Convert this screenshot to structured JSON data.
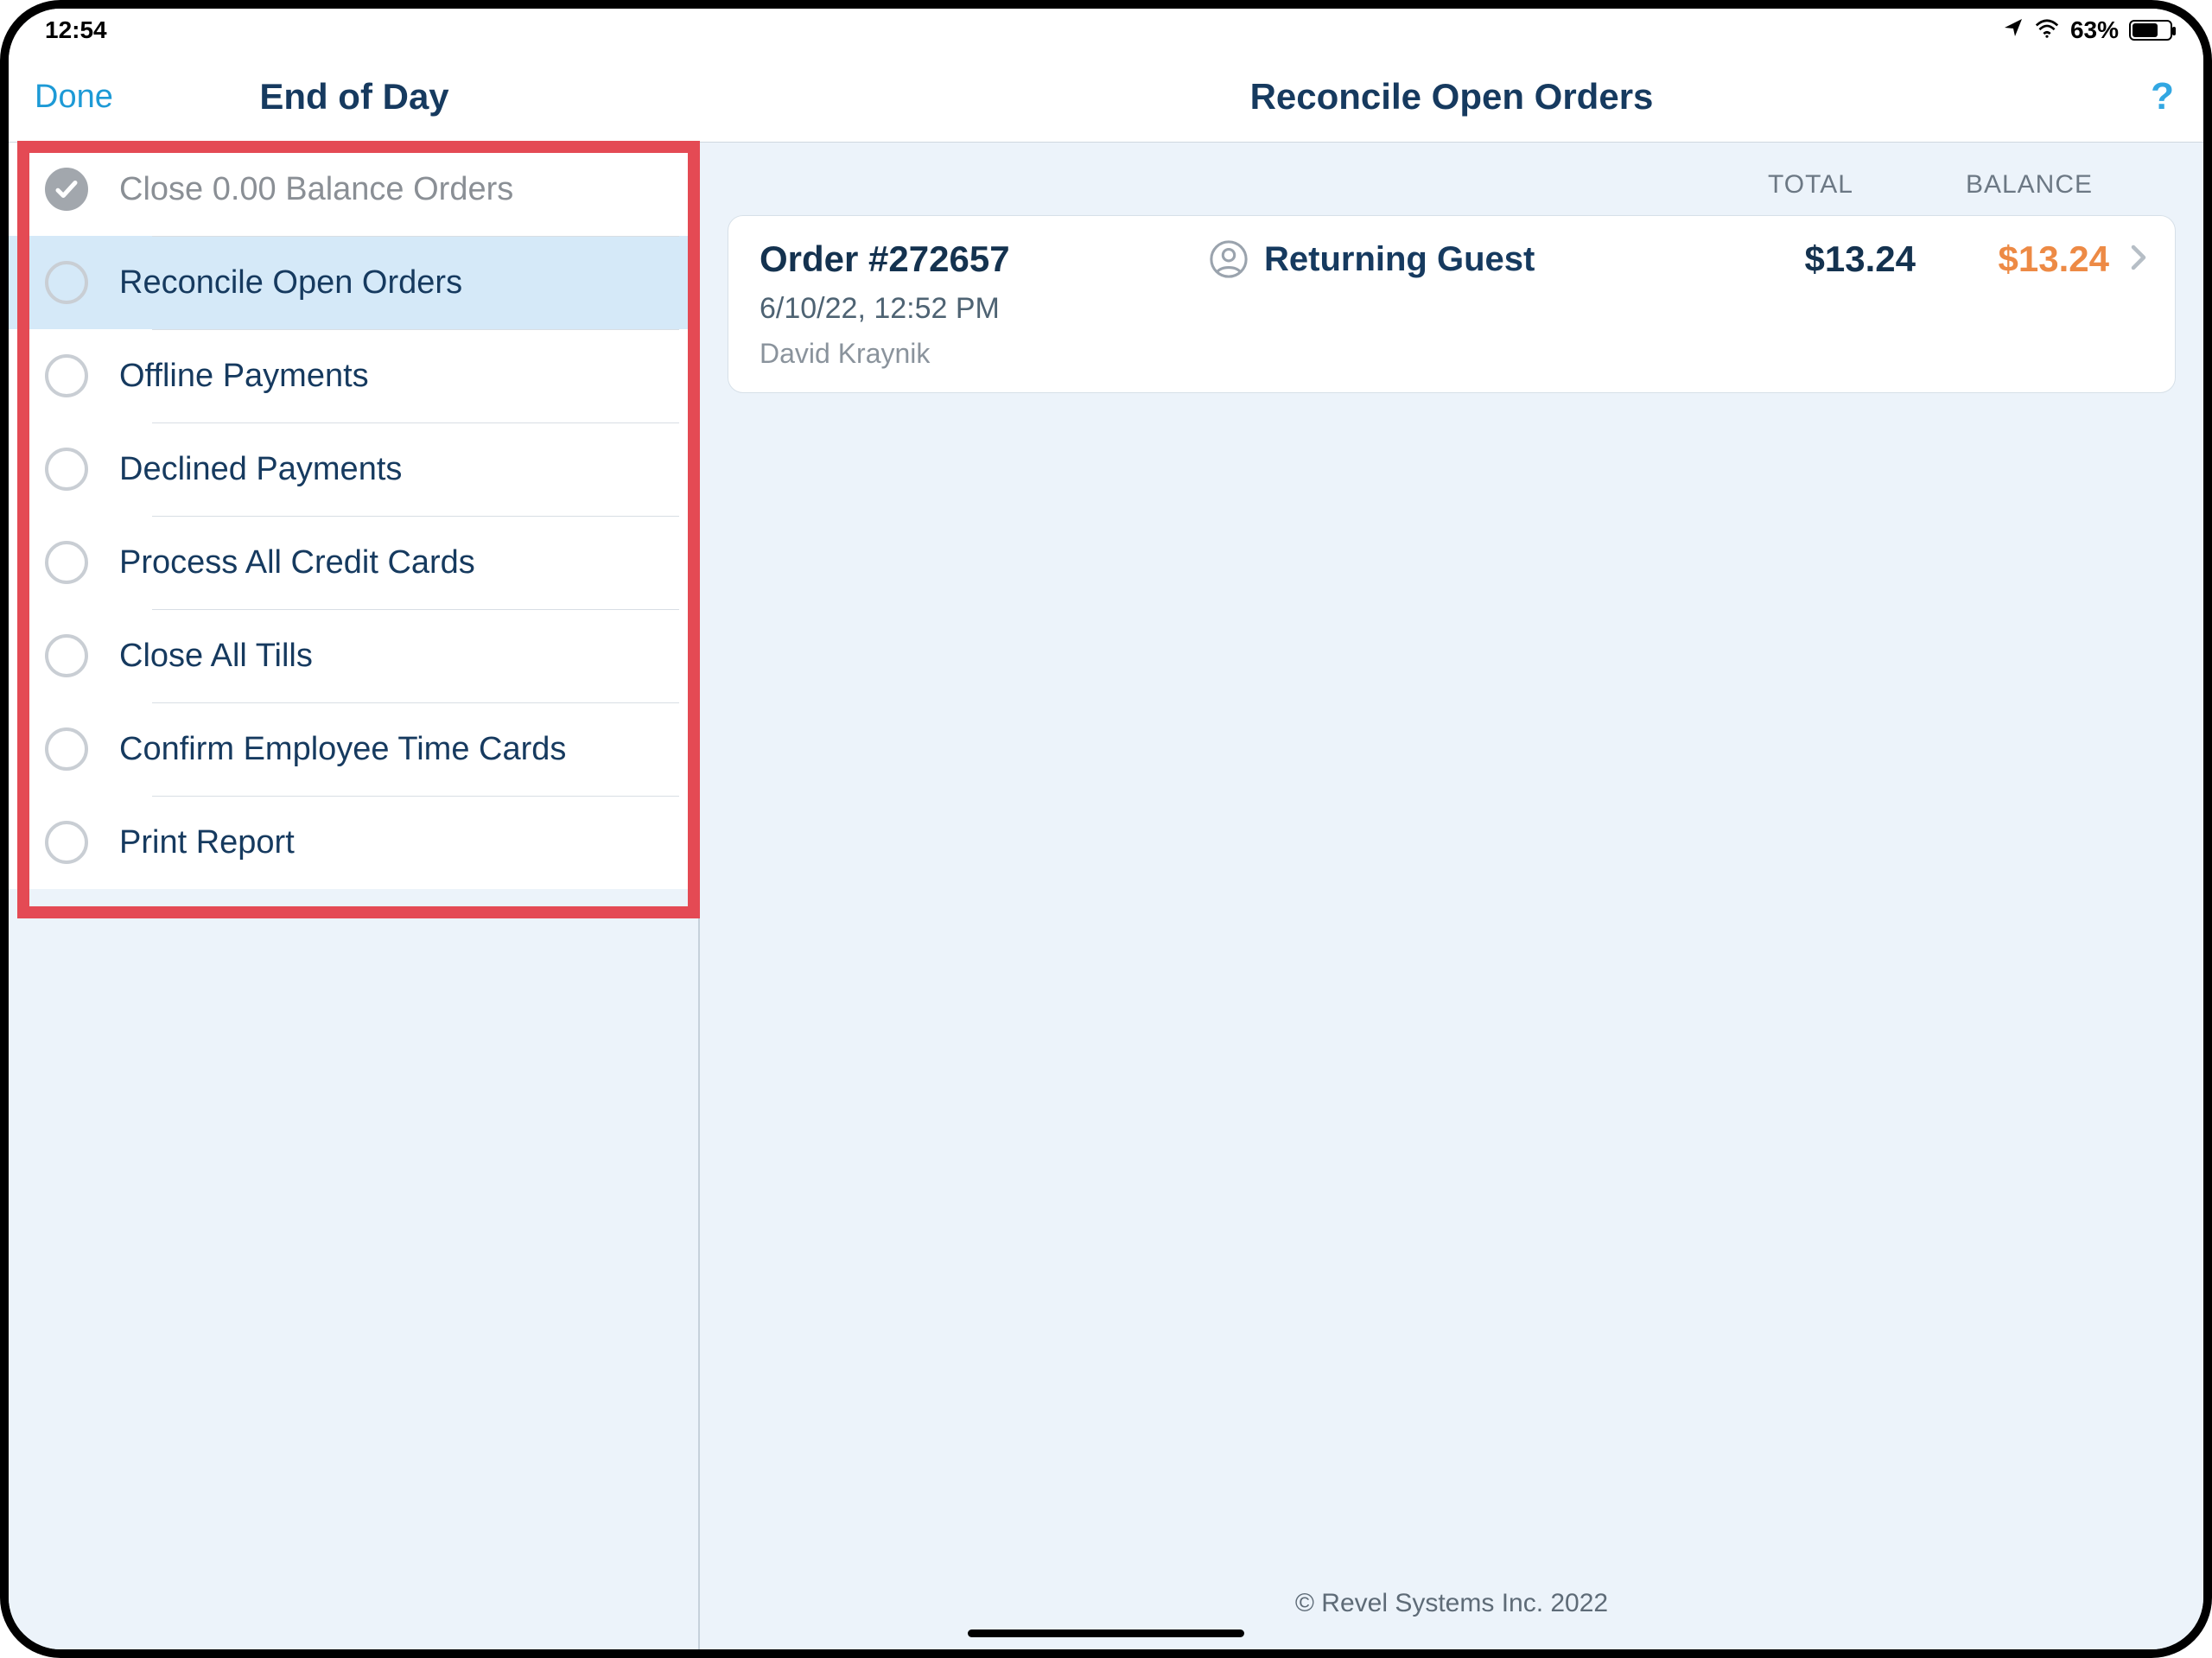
{
  "statusbar": {
    "time": "12:54",
    "battery_pct": "63%",
    "battery_fill_pct": 63
  },
  "header": {
    "done_label": "Done",
    "sidebar_title": "End of Day",
    "content_title": "Reconcile Open Orders",
    "help_label": "?"
  },
  "sidebar": {
    "items": [
      {
        "label": "Close 0.00 Balance Orders",
        "state": "done"
      },
      {
        "label": "Reconcile Open Orders",
        "state": "selected"
      },
      {
        "label": "Offline Payments",
        "state": ""
      },
      {
        "label": "Declined Payments",
        "state": ""
      },
      {
        "label": "Process All Credit Cards",
        "state": ""
      },
      {
        "label": "Close All Tills",
        "state": ""
      },
      {
        "label": "Confirm Employee Time Cards",
        "state": ""
      },
      {
        "label": "Print Report",
        "state": ""
      }
    ]
  },
  "columns": {
    "total": "TOTAL",
    "balance": "BALANCE"
  },
  "orders": [
    {
      "id_label": "Order #272657",
      "guest": "Returning Guest",
      "total": "$13.24",
      "balance": "$13.24",
      "datetime": "6/10/22, 12:52 PM",
      "employee": "David Kraynik"
    }
  ],
  "footer": {
    "copyright": "© Revel Systems Inc. 2022"
  }
}
